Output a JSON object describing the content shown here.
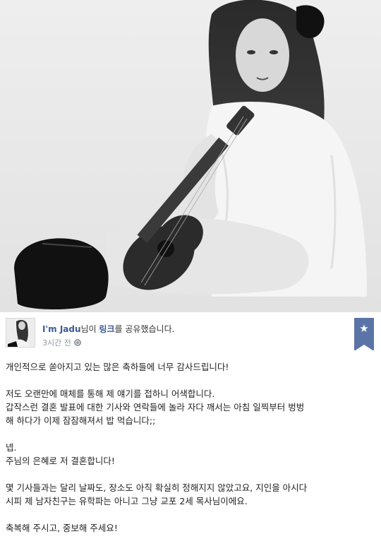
{
  "post": {
    "author_name": "I'm Jadu",
    "author_suffix": "님이 ",
    "link_word": "링크",
    "action_text": "를 공유했습니다.",
    "timestamp": "3시간 전",
    "privacy_icon": "globe-icon",
    "bookmark_icon": "star-icon",
    "body_paragraphs": [
      [
        "개인적으로 쏟아지고 있는 많은 축하들에 너무 감사드립니다!"
      ],
      [
        "저도 오랜만에 매체를 통해 제 얘기를 접하니 어색합니다.",
        "갑작스런 결혼 발표에 대한 기사와 연락들에 놀라 자다 깨서는 아침 일찍부터 벙벙",
        "해 하다가 이제 잠잠해져서 밥 먹습니다;;"
      ],
      [
        "넵.",
        "주님의 은혜로 저 결혼합니다!"
      ],
      [
        "몇 기사들과는 달리 날짜도, 장소도 아직 확실히 정해지지 않았고요, 지인을 아시다",
        "시피 제 남자친구는 유학파는 아니고 그냥 교포 2세 목사님이에요."
      ],
      [
        "축복해 주시고, 중보해 주세요!"
      ]
    ]
  },
  "colors": {
    "link": "#3b5998",
    "meta": "#9197a3",
    "bookmark": "#5b74a8"
  }
}
